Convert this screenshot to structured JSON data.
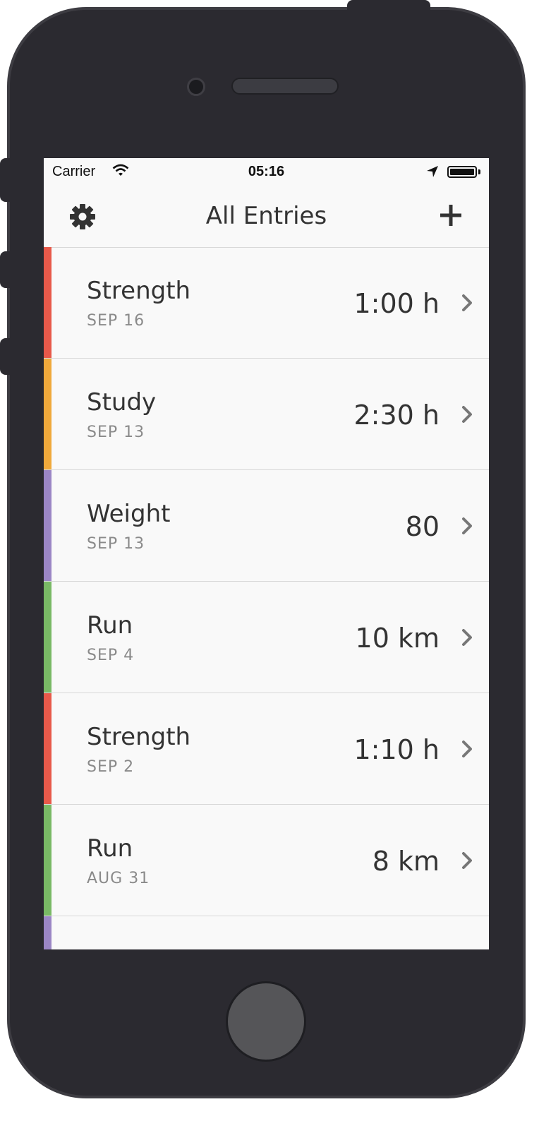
{
  "status_bar": {
    "carrier": "Carrier",
    "time": "05:16"
  },
  "nav": {
    "title": "All Entries"
  },
  "entries": [
    {
      "name": "Strength",
      "date": "SEP 16",
      "value": "1:00 h",
      "color": "#e8594a"
    },
    {
      "name": "Study",
      "date": "SEP 13",
      "value": "2:30 h",
      "color": "#f0a93b"
    },
    {
      "name": "Weight",
      "date": "SEP 13",
      "value": "80",
      "color": "#9b86c5"
    },
    {
      "name": "Run",
      "date": "SEP 4",
      "value": "10 km",
      "color": "#79b965"
    },
    {
      "name": "Strength",
      "date": "SEP 2",
      "value": "1:10 h",
      "color": "#e8594a"
    },
    {
      "name": "Run",
      "date": "AUG 31",
      "value": "8 km",
      "color": "#79b965"
    }
  ],
  "partial_entry_color": "#9b86c5",
  "icons": {
    "settings": "gear-icon",
    "add": "plus-icon",
    "disclosure": "chevron-right-icon",
    "wifi": "wifi-icon",
    "location": "location-arrow-icon",
    "battery": "battery-icon"
  }
}
